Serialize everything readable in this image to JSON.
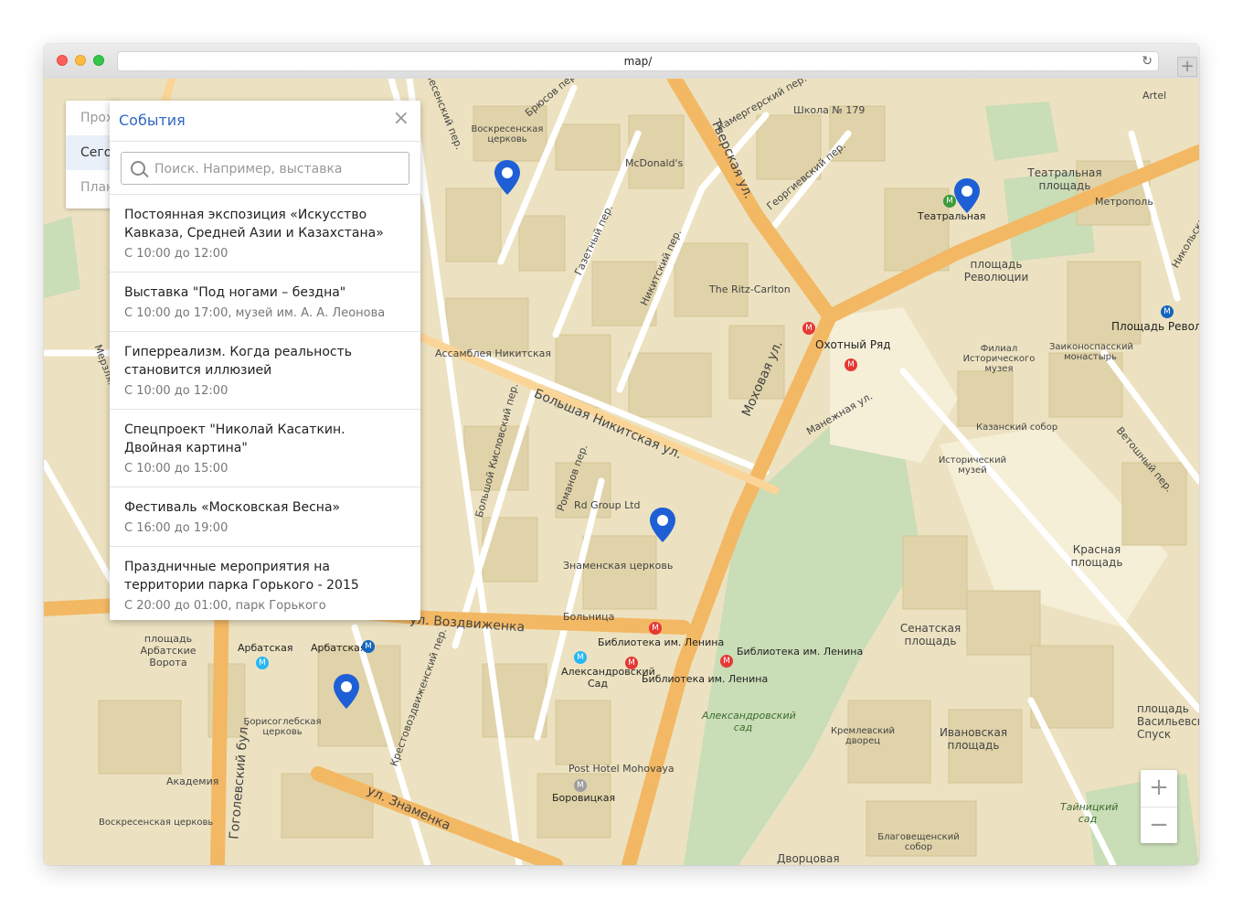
{
  "browser": {
    "url": "map/"
  },
  "side_menu": {
    "items": [
      "Проходящие",
      "Сегодня",
      "Планируемые"
    ]
  },
  "events_panel": {
    "title": "События",
    "close_symbol": "×",
    "search_placeholder": "Поиск. Например, выставка",
    "items": [
      {
        "name": "Постоянная экспозиция «Искусство Кавказа, Средней Азии и Казахстана»",
        "time": "С 10:00 до 12:00"
      },
      {
        "name": "Выставка \"Под ногами – бездна\"",
        "time": "С 10:00 до 17:00, музей им. А. А. Леонова"
      },
      {
        "name": "Гиперреализм. Когда реальность становится иллюзией",
        "time": "С 10:00 до 12:00"
      },
      {
        "name": "Спецпроект \"Николай Касаткин. Двойная картина\"",
        "time": "С 10:00 до 15:00"
      },
      {
        "name": "Фестиваль «Московская Весна»",
        "time": "С 16:00 до 19:00"
      },
      {
        "name": "Праздничные мероприятия на территории парка Горького - 2015",
        "time": "С 20:00 до 01:00, парк Горького"
      }
    ]
  },
  "zoom": {
    "in": "+",
    "out": "−"
  },
  "map": {
    "streets": {
      "tverskaya": "Тверская ул.",
      "mokhovaya": "Моховая ул.",
      "b_nikitskaya": "Большая Никитская ул.",
      "vozdvizhenka": "ул. Воздвиженка",
      "znamenka": "ул. Знаменка",
      "gogolevsky": "Гоголевский бул.",
      "gazetny": "Газетный пер.",
      "nikitsky": "Никитский пер.",
      "georgievsky": "Георгиевский пер.",
      "kamergersky": "Камергерский пер.",
      "bryusov": "Брюсов пер.",
      "voskresensky": "Вознесенский пер.",
      "manezhnaya": "Манежная ул.",
      "b_kislovsky": "Большой Кисловский пер.",
      "romanov": "Романов пер.",
      "krestovozdvizhensky": "Крестовоздвиженский пер.",
      "vetoshny": "Ветошный пер.",
      "merzlyakovsky": "Мерзляковский пер.",
      "nikolskaya": "Никольская"
    },
    "places": {
      "teatralnaya_metro": "Театральная",
      "teatralnaya_square": "Театральная площадь",
      "revolution_square": "площадь Революции",
      "ploshchad_revolyutsii_metro": "Площадь Революции",
      "okhotny_ryad": "Охотный Ряд",
      "mcdonalds": "McDonald's",
      "ritz": "The Ritz-Carlton",
      "assambleya": "Ассамблея Никитская",
      "voskresenskaya_church": "Воскресенская церковь",
      "school": "Школа № 179",
      "metropol": "Метрополь",
      "artel": "Artel",
      "filial_museum": "Филиал Исторического музея",
      "zaikonospassky": "Заиконоспасский монастырь",
      "kazan_cathedral": "Казанский собор",
      "historical_museum": "Исторический музей",
      "krasnaya_square": "Красная площадь",
      "senate_square": "Сенатская площадь",
      "rd_group": "Rd Group Ltd",
      "znamenskaya": "Знаменская церковь",
      "hospital": "Больница",
      "lenin_library_1": "Библиотека им. Ленина",
      "lenin_library_2": "Библиотека им. Ленина",
      "lenin_library_3": "Библиотека им. Ленина",
      "aleksandrovsky_metro": "Александровский Сад",
      "aleksandrovsky_garden": "Александровский сад",
      "arbatskaya_1": "Арбатская",
      "arbatskaya_2": "Арбатская",
      "arbat_gates": "площадь Арбатские Ворота",
      "borisoglebsky": "Борисоглебская церковь",
      "academy": "Академия",
      "voskresenskaya_2": "Воскресенская церковь",
      "post_hotel": "Post Hotel Mohovaya",
      "borovitskaya": "Боровицкая",
      "kremlin_palace": "Кремлевский дворец",
      "ivanovskaya": "Ивановская площадь",
      "vasilevsky": "площадь Васильевский Спуск",
      "tainitsky": "Тайницкий сад",
      "blagoveshchensky": "Благовещенский собор",
      "dvortsovaya": "Дворцовая"
    }
  },
  "colors": {
    "accent": "#3067c5",
    "pin": "#1f5fd6",
    "road": "#f4bc62",
    "park": "#c5dcb4",
    "metro_red": "#e53935",
    "metro_blue": "#1565c0"
  }
}
